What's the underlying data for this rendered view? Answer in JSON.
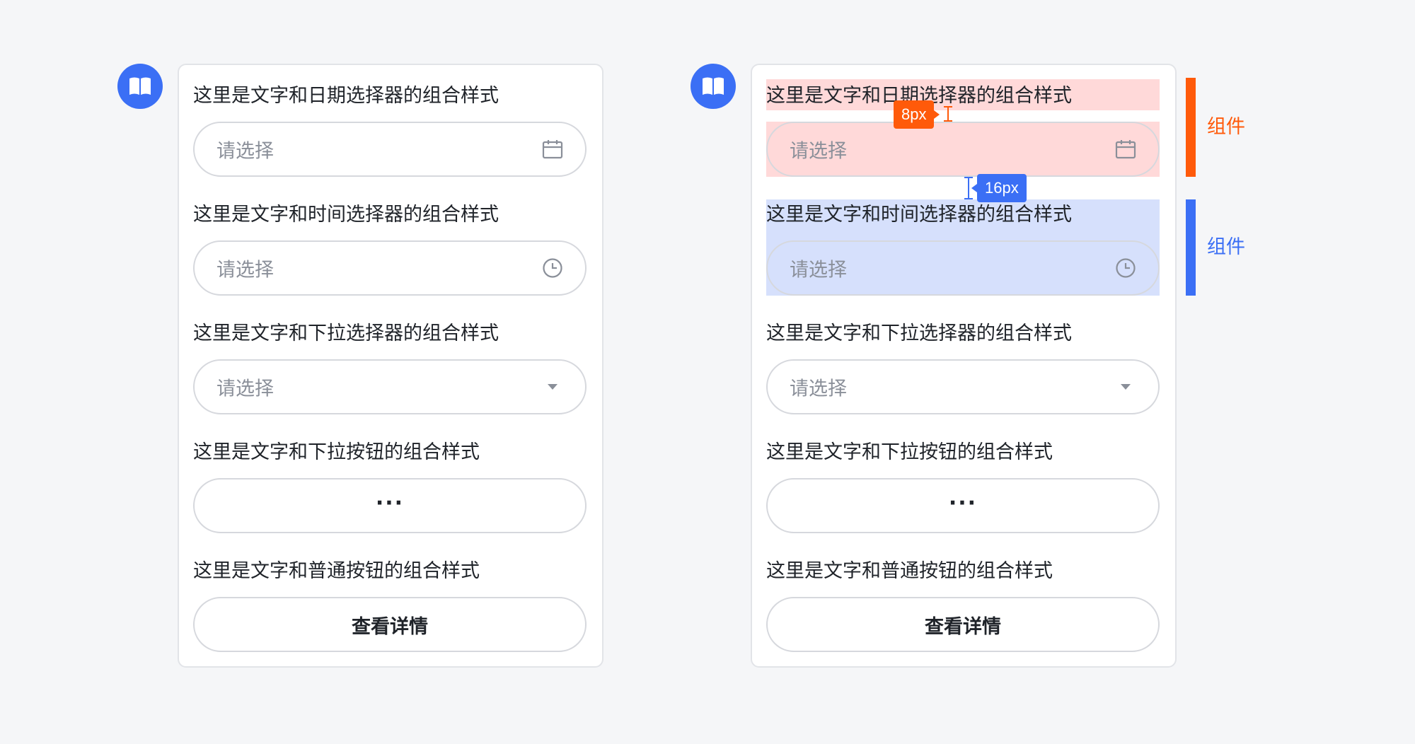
{
  "panels": [
    {
      "groups": [
        {
          "label": "这里是文字和日期选择器的组合样式",
          "placeholder": "请选择",
          "icon": "calendar-icon"
        },
        {
          "label": "这里是文字和时间选择器的组合样式",
          "placeholder": "请选择",
          "icon": "clock-icon"
        },
        {
          "label": "这里是文字和下拉选择器的组合样式",
          "placeholder": "请选择",
          "icon": "caret-down-icon"
        },
        {
          "label": "这里是文字和下拉按钮的组合样式",
          "button_text": "···",
          "icon": "more-icon"
        },
        {
          "label": "这里是文字和普通按钮的组合样式",
          "button_text": "查看详情"
        }
      ]
    },
    {
      "groups": [
        {
          "label": "这里是文字和日期选择器的组合样式",
          "placeholder": "请选择",
          "icon": "calendar-icon"
        },
        {
          "label": "这里是文字和时间选择器的组合样式",
          "placeholder": "请选择",
          "icon": "clock-icon"
        },
        {
          "label": "这里是文字和下拉选择器的组合样式",
          "placeholder": "请选择",
          "icon": "caret-down-icon"
        },
        {
          "label": "这里是文字和下拉按钮的组合样式",
          "button_text": "···",
          "icon": "more-icon"
        },
        {
          "label": "这里是文字和普通按钮的组合样式",
          "button_text": "查看详情"
        }
      ]
    }
  ],
  "annotations": {
    "gap_label_small": "8px",
    "gap_label_large": "16px",
    "component_label_1": "组件",
    "component_label_2": "组件"
  },
  "colors": {
    "brand_blue": "#3b6ff5",
    "annotation_orange": "#ff5a0a",
    "highlight_red": "rgba(255,120,120,0.28)",
    "highlight_blue": "rgba(90,130,245,0.25)"
  },
  "avatar_icon": "book-icon"
}
